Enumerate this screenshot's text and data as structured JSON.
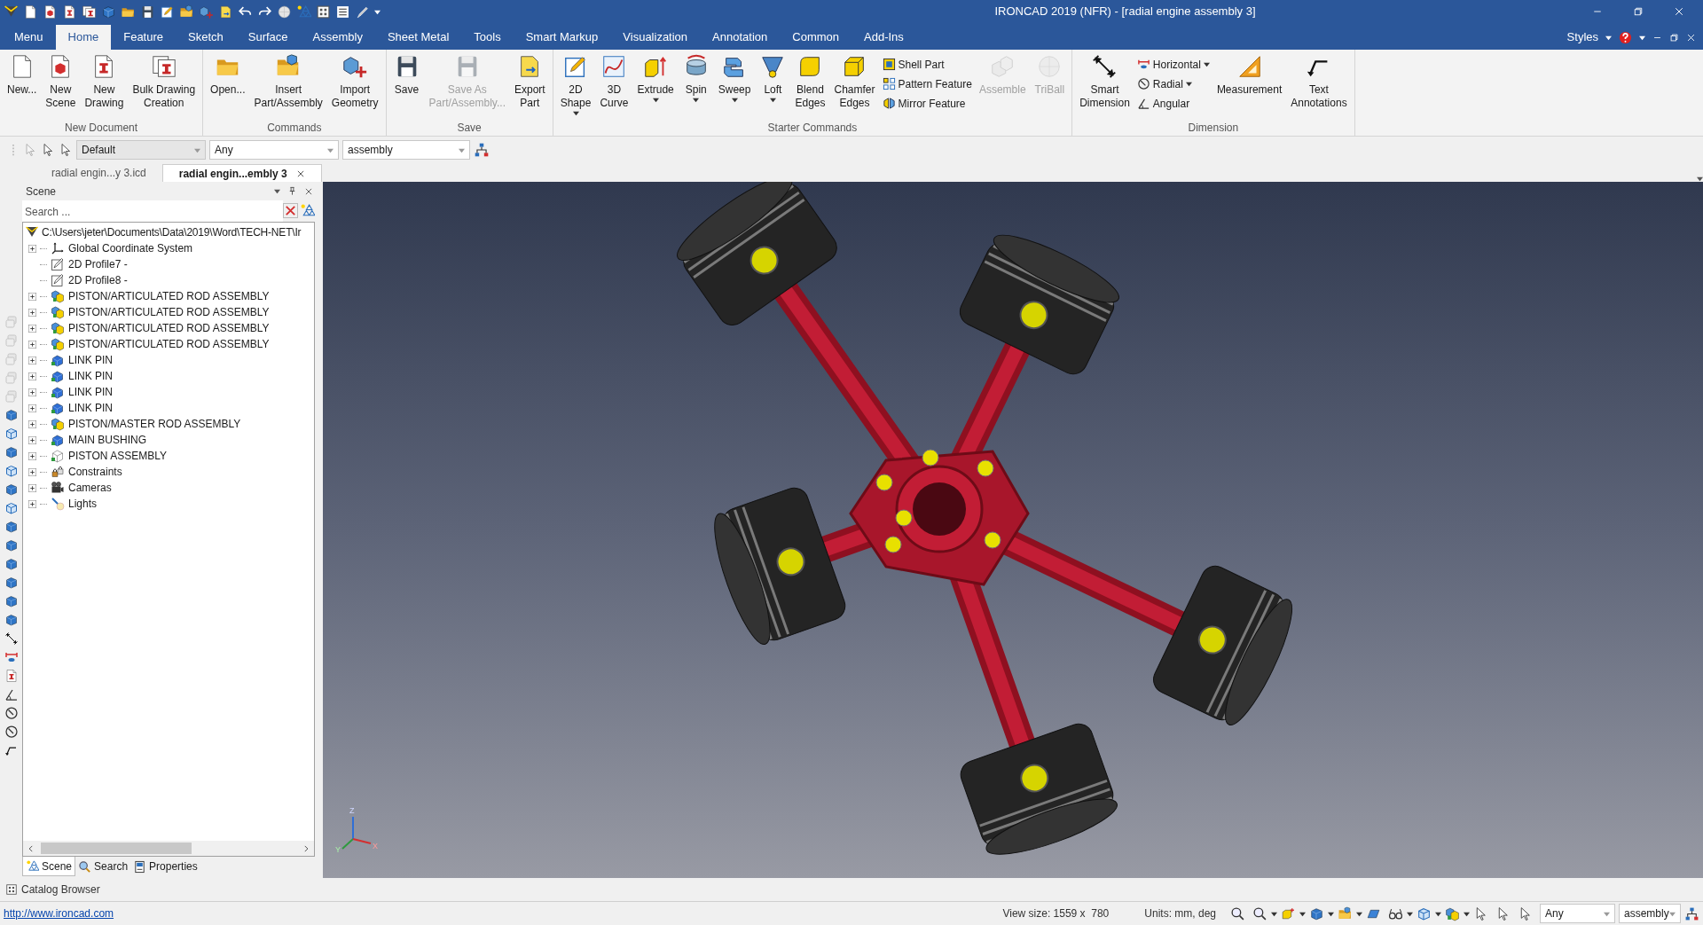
{
  "window": {
    "title": "IRONCAD 2019 (NFR) - [radial engine assembly 3]"
  },
  "ribbon_tabs": [
    {
      "label": "Menu",
      "selected": false
    },
    {
      "label": "Home",
      "selected": true
    },
    {
      "label": "Feature",
      "selected": false
    },
    {
      "label": "Sketch",
      "selected": false
    },
    {
      "label": "Surface",
      "selected": false
    },
    {
      "label": "Assembly",
      "selected": false
    },
    {
      "label": "Sheet Metal",
      "selected": false
    },
    {
      "label": "Tools",
      "selected": false
    },
    {
      "label": "Smart Markup",
      "selected": false
    },
    {
      "label": "Visualization",
      "selected": false
    },
    {
      "label": "Annotation",
      "selected": false
    },
    {
      "label": "Common",
      "selected": false
    },
    {
      "label": "Add-Ins",
      "selected": false
    }
  ],
  "styles_menu": {
    "label": "Styles"
  },
  "ribbon_groups": [
    {
      "title": "New Document",
      "items": [
        {
          "kind": "large",
          "label": "New...",
          "disabled": false,
          "dropdown": false
        },
        {
          "kind": "large",
          "label": "New\nScene",
          "disabled": false,
          "dropdown": false
        },
        {
          "kind": "large",
          "label": "New\nDrawing",
          "disabled": false,
          "dropdown": false
        },
        {
          "kind": "large",
          "label": "Bulk Drawing\nCreation",
          "disabled": false,
          "dropdown": false
        }
      ]
    },
    {
      "title": "Commands",
      "items": [
        {
          "kind": "large",
          "label": "Open...",
          "disabled": false,
          "dropdown": false
        },
        {
          "kind": "large",
          "label": "Insert\nPart/Assembly",
          "disabled": false,
          "dropdown": false
        },
        {
          "kind": "large",
          "label": "Import\nGeometry",
          "disabled": false,
          "dropdown": false
        }
      ]
    },
    {
      "title": "Save",
      "items": [
        {
          "kind": "large",
          "label": "Save",
          "disabled": false,
          "dropdown": false
        },
        {
          "kind": "large",
          "label": "Save As\nPart/Assembly...",
          "disabled": true,
          "dropdown": false
        },
        {
          "kind": "large",
          "label": "Export\nPart",
          "disabled": false,
          "dropdown": false
        }
      ]
    },
    {
      "title": "Starter Commands",
      "items": [
        {
          "kind": "large",
          "label": "2D\nShape",
          "disabled": false,
          "dropdown": true
        },
        {
          "kind": "large",
          "label": "3D\nCurve",
          "disabled": false,
          "dropdown": false
        },
        {
          "kind": "large",
          "label": "Extrude",
          "disabled": false,
          "dropdown": true
        },
        {
          "kind": "large",
          "label": "Spin",
          "disabled": false,
          "dropdown": true
        },
        {
          "kind": "large",
          "label": "Sweep",
          "disabled": false,
          "dropdown": true
        },
        {
          "kind": "large",
          "label": "Loft",
          "disabled": false,
          "dropdown": true
        },
        {
          "kind": "large",
          "label": "Blend\nEdges",
          "disabled": false,
          "dropdown": false
        },
        {
          "kind": "large",
          "label": "Chamfer\nEdges",
          "disabled": false,
          "dropdown": false
        },
        {
          "kind": "small",
          "label": "Shell Part",
          "disabled": false,
          "dropdown": false
        },
        {
          "kind": "small",
          "label": "Pattern Feature",
          "disabled": false,
          "dropdown": false
        },
        {
          "kind": "small",
          "label": "Mirror Feature",
          "disabled": false,
          "dropdown": false
        },
        {
          "kind": "large",
          "label": "Assemble",
          "disabled": true,
          "dropdown": false
        },
        {
          "kind": "large",
          "label": "TriBall",
          "disabled": true,
          "dropdown": false
        }
      ]
    },
    {
      "title": "Dimension",
      "items": [
        {
          "kind": "large",
          "label": "Smart\nDimension",
          "disabled": false,
          "dropdown": false
        },
        {
          "kind": "small",
          "label": "Horizontal",
          "disabled": false,
          "dropdown": true
        },
        {
          "kind": "small",
          "label": "Radial",
          "disabled": false,
          "dropdown": true
        },
        {
          "kind": "small",
          "label": "Angular",
          "disabled": false,
          "dropdown": false
        },
        {
          "kind": "large",
          "label": "Measurement",
          "disabled": false,
          "dropdown": false
        },
        {
          "kind": "large",
          "label": "Text\nAnnotations",
          "disabled": false,
          "dropdown": false
        }
      ]
    }
  ],
  "toolbar": {
    "style_combo": "Default",
    "filter_combo": "Any",
    "scope_combo": "assembly"
  },
  "document_tabs": [
    {
      "label": "radial engin...y 3.icd",
      "selected": false
    },
    {
      "label": "radial engin...embly 3",
      "selected": true
    }
  ],
  "scene_panel": {
    "title": "Scene",
    "search": {
      "placeholder": "Search ..."
    },
    "tree": {
      "label": "C:\\Users\\jeter\\Documents\\Data\\2019\\Word\\TECH-NET\\Ir",
      "children": [
        {
          "label": "Global Coordinate System",
          "kind": "coordinate",
          "expandable": true
        },
        {
          "label": "2D Profile7 -",
          "kind": "profile",
          "expandable": false
        },
        {
          "label": "2D Profile8 -",
          "kind": "profile",
          "expandable": false
        },
        {
          "label": "PISTON/ARTICULATED ROD ASSEMBLY",
          "kind": "assembly",
          "expandable": true
        },
        {
          "label": "PISTON/ARTICULATED ROD ASSEMBLY",
          "kind": "assembly",
          "expandable": true
        },
        {
          "label": "PISTON/ARTICULATED ROD ASSEMBLY",
          "kind": "assembly",
          "expandable": true
        },
        {
          "label": "PISTON/ARTICULATED ROD ASSEMBLY",
          "kind": "assembly",
          "expandable": true
        },
        {
          "label": "LINK PIN",
          "kind": "part",
          "expandable": true
        },
        {
          "label": "LINK PIN",
          "kind": "part",
          "expandable": true
        },
        {
          "label": "LINK PIN",
          "kind": "part",
          "expandable": true
        },
        {
          "label": "LINK PIN",
          "kind": "part",
          "expandable": true
        },
        {
          "label": "PISTON/MASTER ROD ASSEMBLY",
          "kind": "assembly",
          "expandable": true
        },
        {
          "label": "MAIN BUSHING",
          "kind": "part",
          "expandable": true
        },
        {
          "label": "PISTON ASSEMBLY",
          "kind": "outline",
          "expandable": true
        },
        {
          "label": "Constraints",
          "kind": "constraints",
          "expandable": true
        },
        {
          "label": "Cameras",
          "kind": "cameras",
          "expandable": true
        },
        {
          "label": "Lights",
          "kind": "lights",
          "expandable": true
        }
      ]
    },
    "tabs": [
      {
        "label": "Scene",
        "selected": true
      },
      {
        "label": "Search",
        "selected": false
      },
      {
        "label": "Properties",
        "selected": false
      }
    ]
  },
  "catalog_browser": {
    "label": "Catalog Browser"
  },
  "viewport": {
    "axis_labels": [
      "Z",
      "Y",
      "X"
    ]
  },
  "status_bar": {
    "link": "http://www.ironcad.com",
    "view_size": "View size: 1559 x  780",
    "units": "Units: mm, deg",
    "filter_combo": "Any",
    "scope_combo": "assembly"
  }
}
